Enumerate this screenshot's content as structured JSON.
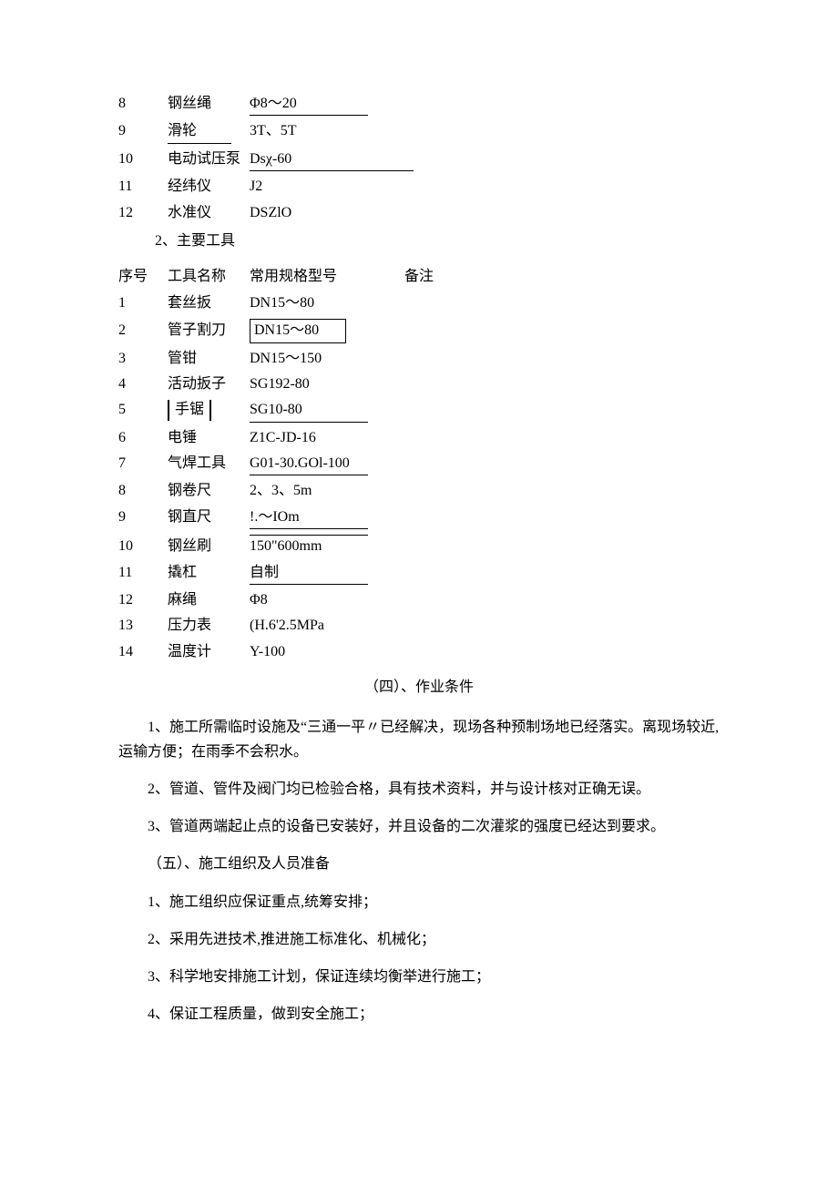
{
  "table1": {
    "rows": [
      {
        "seq": "8",
        "name": "钢丝绳",
        "spec": "Φ8～20"
      },
      {
        "seq": "9",
        "name": "滑轮",
        "spec": "3T、5T"
      },
      {
        "seq": "10",
        "name": "电动试压泵",
        "spec": "Dsχ-60"
      },
      {
        "seq": "11",
        "name": "经纬仪",
        "spec": "J2"
      },
      {
        "seq": "12",
        "name": "水准仪",
        "spec": "DSZlO"
      }
    ]
  },
  "line_main_tools": "2、主要工具",
  "table2_header": {
    "seq": "序号",
    "name": "工具名称",
    "spec": "常用规格型号",
    "rem": "备注"
  },
  "table2": {
    "rows": [
      {
        "seq": "1",
        "name": "套丝扳",
        "spec": "DN15～80"
      },
      {
        "seq": "2",
        "name": "管子割刀",
        "spec": "DN15～80"
      },
      {
        "seq": "3",
        "name": "管钳",
        "spec": "DN15～150"
      },
      {
        "seq": "4",
        "name": "活动扳子",
        "spec": "SG192-80"
      },
      {
        "seq": "5",
        "name": "手锯",
        "spec": "SG10-80"
      },
      {
        "seq": "6",
        "name": "电锤",
        "spec": "Z1C-JD-16"
      },
      {
        "seq": "7",
        "name": "气焊工具",
        "spec": "G01-30.GOl-100"
      },
      {
        "seq": "8",
        "name": "钢卷尺",
        "spec": "2、3、5m"
      },
      {
        "seq": "9",
        "name": "钢直尺",
        "spec": "!.～IOm"
      },
      {
        "seq": "10",
        "name": "钢丝刷",
        "spec": "150\"600mm"
      },
      {
        "seq": "11",
        "name": "撬杠",
        "spec": "自制"
      },
      {
        "seq": "12",
        "name": "麻绳",
        "spec": "Φ8"
      },
      {
        "seq": "13",
        "name": "压力表",
        "spec": "(H.6'2.5MPa"
      },
      {
        "seq": "14",
        "name": "温度计",
        "spec": "Y-100"
      }
    ]
  },
  "heading4": "（四）、作业条件",
  "p1": "1、施工所需临时设施及“三通一平〃已经解决，现场各种预制场地已经落实。离现场较近,运输方便；在雨季不会积水。",
  "p2": "2、管道、管件及阀门均已检验合格，具有技术资料，并与设计核对正确无误。",
  "p3": "3、管道两端起止点的设备已安装好，并且设备的二次灌浆的强度已经达到要求。",
  "heading5": "（五）、施工组织及人员准备",
  "p4": "1、施工组织应保证重点,统筹安排；",
  "p5": "2、采用先进技术,推进施工标准化、机械化；",
  "p6": "3、科学地安排施工计划，保证连续均衡举进行施工；",
  "p7": "4、保证工程质量，做到安全施工；"
}
